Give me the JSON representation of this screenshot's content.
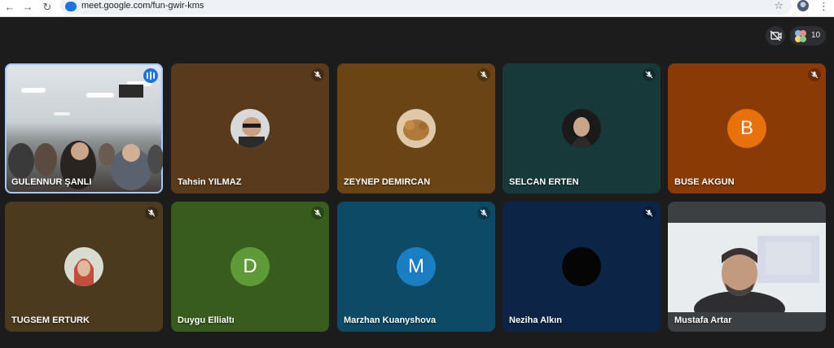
{
  "browser": {
    "url": "meet.google.com/fun-gwir-kms",
    "back_icon": "back-arrow-icon",
    "forward_icon": "forward-arrow-icon",
    "reload_icon": "reload-icon"
  },
  "meet": {
    "participant_count": "10"
  },
  "participants": [
    {
      "name": "GULENNUR ŞANLI",
      "tile_color": "#cfd6db",
      "type": "video",
      "speaking": true
    },
    {
      "name": "Tahsin YILMAZ",
      "tile_color": "#5a3a1c",
      "type": "photo",
      "muted": true
    },
    {
      "name": "ZEYNEP DEMIRCAN",
      "tile_color": "#6a4414",
      "type": "photo",
      "muted": true
    },
    {
      "name": "SELCAN ERTEN",
      "tile_color": "#17393a",
      "type": "photo",
      "muted": true
    },
    {
      "name": "BUSE AKGUN",
      "tile_color": "#8a3a05",
      "type": "initial",
      "initial": "B",
      "avatar_color": "#e8710a",
      "muted": true
    },
    {
      "name": "TUGSEM ERTURK",
      "tile_color": "#4b3a1e",
      "type": "photo",
      "muted": true
    },
    {
      "name": "Duygu Ellialtı",
      "tile_color": "#375c1e",
      "type": "initial",
      "initial": "D",
      "avatar_color": "#5e9a37",
      "muted": true
    },
    {
      "name": "Marzhan Kuanyshova",
      "tile_color": "#0c4a66",
      "type": "initial",
      "initial": "M",
      "avatar_color": "#1a7ec2",
      "muted": true
    },
    {
      "name": "Neziha Alkın",
      "tile_color": "#0c2547",
      "type": "photo",
      "muted": true
    },
    {
      "name": "Mustafa Artar",
      "tile_color": "#3c4043",
      "type": "video",
      "muted": false
    }
  ]
}
